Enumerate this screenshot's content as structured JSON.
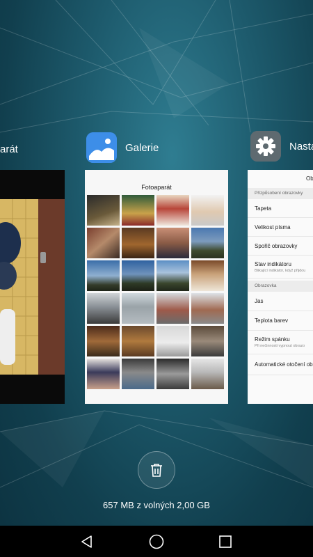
{
  "apps": {
    "camera": {
      "name": "Fotoaparát",
      "visible_name": "arát"
    },
    "gallery": {
      "name": "Galerie",
      "screen_title": "Fotoaparát"
    },
    "settings": {
      "name": "Nastavení",
      "visible_name": "Nasta"
    }
  },
  "settings_screen": {
    "title": "Ob",
    "section1": "Přizpůsobení obrazovky",
    "items1": [
      {
        "label": "Tapeta"
      },
      {
        "label": "Velikost písma"
      },
      {
        "label": "Spořič obrazovky"
      },
      {
        "label": "Stav indikátoru",
        "sub": "Blikající indikátor, když přijdou"
      }
    ],
    "section2": "Obrazovka",
    "items2": [
      {
        "label": "Jas"
      },
      {
        "label": "Teplota barev"
      },
      {
        "label": "Režim spánku",
        "sub": "Při nečinnosti vypnout obrazo"
      },
      {
        "label": "Automatické otočení ob"
      }
    ]
  },
  "memory": {
    "text": "657 MB z volných 2,00 GB"
  },
  "icons": {
    "gallery": "gallery-icon",
    "settings": "gear-icon",
    "trash": "trash-icon",
    "nav_back": "back-triangle-icon",
    "nav_home": "home-circle-icon",
    "nav_recents": "recents-square-icon"
  },
  "colors": {
    "gallery_icon": "#3d8ee8",
    "settings_icon": "#5e6a70",
    "navbar": "#000000"
  }
}
